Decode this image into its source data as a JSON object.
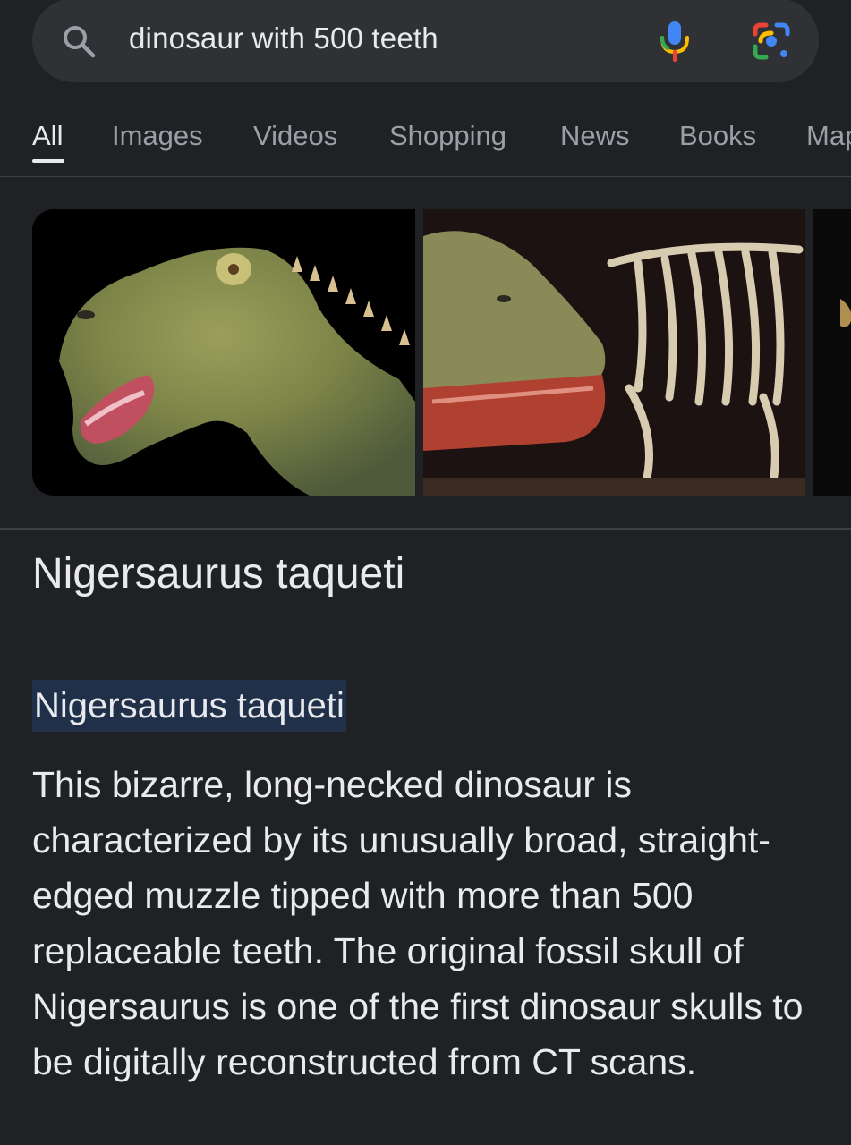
{
  "search": {
    "query": "dinosaur with 500 teeth"
  },
  "tabs": [
    {
      "label": "All",
      "active": true
    },
    {
      "label": "Images"
    },
    {
      "label": "Videos"
    },
    {
      "label": "Shopping"
    },
    {
      "label": "News"
    },
    {
      "label": "Books"
    },
    {
      "label": "Maps"
    }
  ],
  "icons": {
    "search": "search-icon",
    "mic": "mic-icon",
    "lens": "lens-icon"
  },
  "colors": {
    "background": "#202124",
    "search_bar": "#303134",
    "highlight": "#203048",
    "google_blue": "#4285f4",
    "google_red": "#ea4335",
    "google_yellow": "#fbbc04",
    "google_green": "#34a853"
  },
  "result": {
    "title": "Nigersaurus taqueti",
    "highlighted_text": "Nigersaurus taqueti",
    "description": "This bizarre, long-necked dinosaur is characterized by its unusually broad, straight-edged muzzle tipped with more than 500 replaceable teeth. The original fossil skull of Nigersaurus is one of the first dinosaur skulls to be digitally reconstructed from CT scans."
  }
}
